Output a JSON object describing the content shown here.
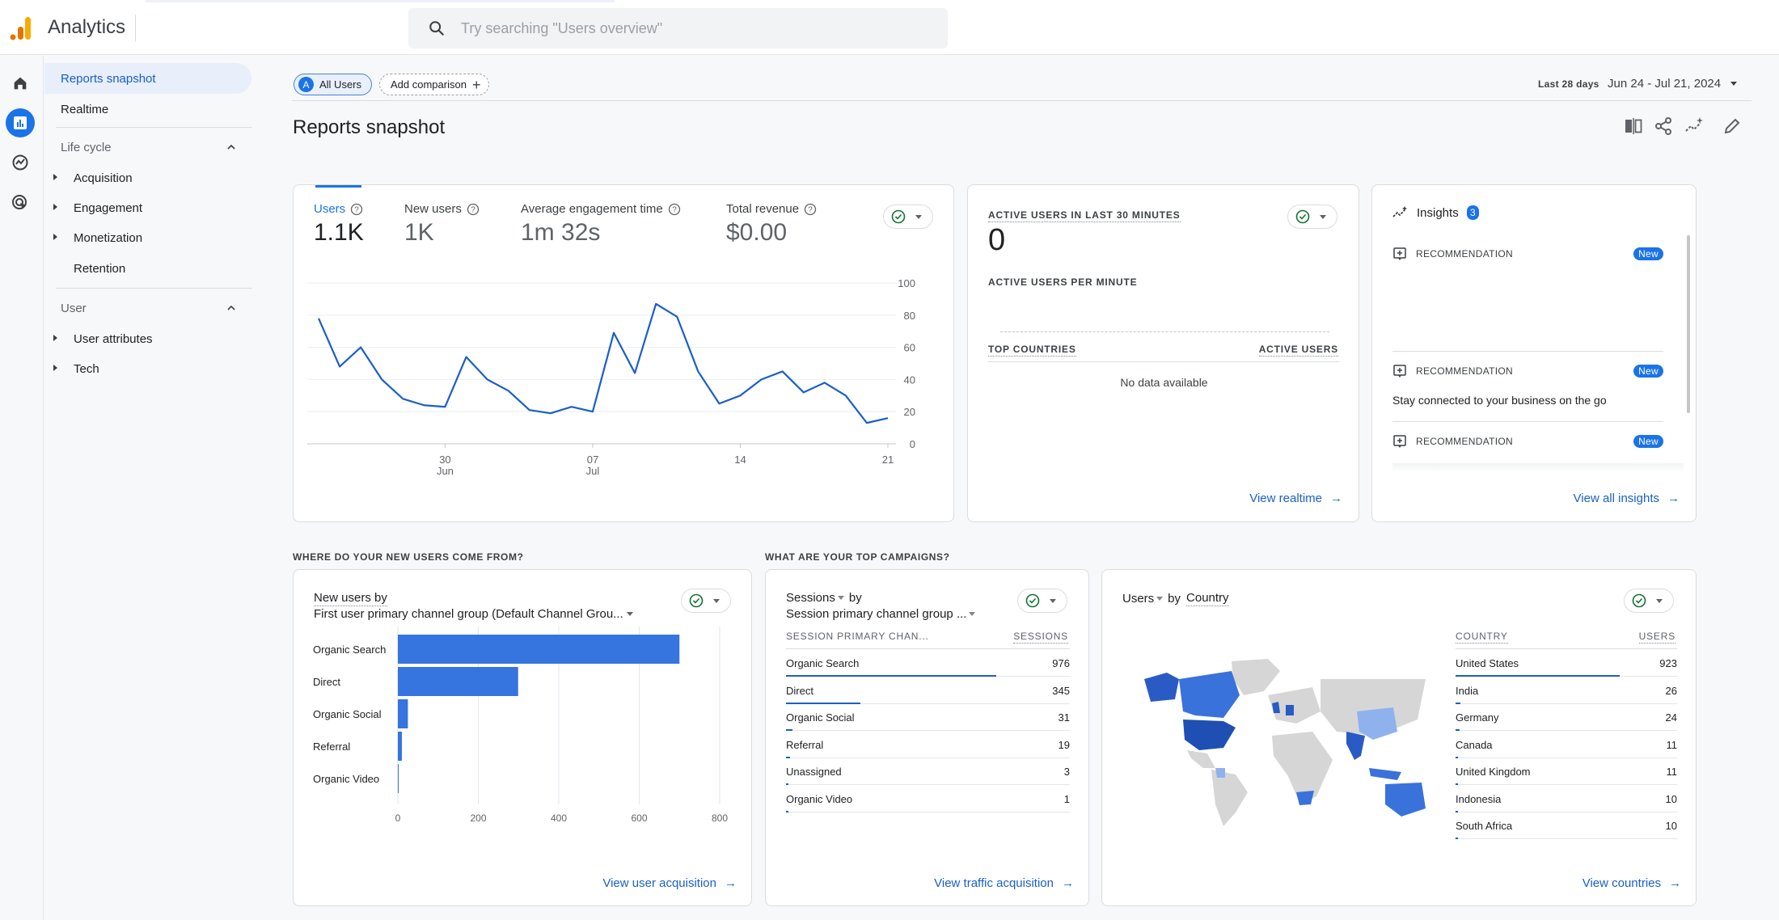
{
  "app": {
    "title": "Analytics"
  },
  "search": {
    "placeholder": "Try searching \"Users overview\"",
    "value": ""
  },
  "rail": [
    {
      "name": "home",
      "label": "Home"
    },
    {
      "name": "reports",
      "label": "Reports"
    },
    {
      "name": "explore",
      "label": "Explore"
    },
    {
      "name": "advertising",
      "label": "Advertising"
    }
  ],
  "nav": {
    "top_items": [
      "Reports snapshot",
      "Realtime"
    ],
    "sections": [
      {
        "title": "Life cycle",
        "items": [
          {
            "label": "Acquisition",
            "expandable": true
          },
          {
            "label": "Engagement",
            "expandable": true
          },
          {
            "label": "Monetization",
            "expandable": true
          },
          {
            "label": "Retention",
            "expandable": false
          }
        ]
      },
      {
        "title": "User",
        "items": [
          {
            "label": "User attributes",
            "expandable": true
          },
          {
            "label": "Tech",
            "expandable": true
          }
        ]
      }
    ]
  },
  "filters": {
    "segment_avatar": "A",
    "segment_label": "All Users",
    "add_comparison": "Add comparison",
    "date_range_label": "Last 28 days",
    "date_range_value": "Jun 24 - Jul 21, 2024"
  },
  "page": {
    "title": "Reports snapshot"
  },
  "toolbar": [
    "compare-icon",
    "share-icon",
    "insights-icon",
    "edit-icon"
  ],
  "metrics_card": {
    "metrics": [
      {
        "label": "Users",
        "value": "1.1K",
        "active": true
      },
      {
        "label": "New users",
        "value": "1K",
        "active": false
      },
      {
        "label": "Average engagement time",
        "value": "1m 32s",
        "active": false
      },
      {
        "label": "Total revenue",
        "value": "$0.00",
        "active": false
      }
    ]
  },
  "realtime_card": {
    "title": "ACTIVE USERS IN LAST 30 MINUTES",
    "value": "0",
    "per_minute_label": "ACTIVE USERS PER MINUTE",
    "col_country": "TOP COUNTRIES",
    "col_users": "ACTIVE USERS",
    "empty": "No data available",
    "link": "View realtime"
  },
  "insights_card": {
    "title": "Insights",
    "count": "3",
    "items": [
      {
        "type": "RECOMMENDATION",
        "badge": "New",
        "text": ""
      },
      {
        "type": "RECOMMENDATION",
        "badge": "New",
        "text": "Stay connected to your business on the go"
      },
      {
        "type": "RECOMMENDATION",
        "badge": "New",
        "text": ""
      }
    ],
    "link": "View all insights"
  },
  "sections": {
    "new_users_q": "WHERE DO YOUR NEW USERS COME FROM?",
    "campaigns_q": "WHAT ARE YOUR TOP CAMPAIGNS?"
  },
  "new_users_card": {
    "metric": "New users by",
    "dimension": "First user primary channel group (Default Channel Grou...",
    "link": "View user acquisition"
  },
  "sessions_card": {
    "metric": "Sessions",
    "by": "by",
    "dimension": "Session primary channel group ...",
    "col_dim": "SESSION PRIMARY CHAN...",
    "col_val": "SESSIONS",
    "rows": [
      {
        "label": "Organic Search",
        "value": "976",
        "n": 976
      },
      {
        "label": "Direct",
        "value": "345",
        "n": 345
      },
      {
        "label": "Organic Social",
        "value": "31",
        "n": 31
      },
      {
        "label": "Referral",
        "value": "19",
        "n": 19
      },
      {
        "label": "Unassigned",
        "value": "3",
        "n": 3
      },
      {
        "label": "Organic Video",
        "value": "1",
        "n": 1
      }
    ],
    "link": "View traffic acquisition"
  },
  "country_card": {
    "metric": "Users",
    "by": "by",
    "dimension": "Country",
    "col_dim": "COUNTRY",
    "col_val": "USERS",
    "rows": [
      {
        "label": "United States",
        "value": "923",
        "n": 923
      },
      {
        "label": "India",
        "value": "26",
        "n": 26
      },
      {
        "label": "Germany",
        "value": "24",
        "n": 24
      },
      {
        "label": "Canada",
        "value": "11",
        "n": 11
      },
      {
        "label": "United Kingdom",
        "value": "11",
        "n": 11
      },
      {
        "label": "Indonesia",
        "value": "10",
        "n": 10
      },
      {
        "label": "South Africa",
        "value": "10",
        "n": 10
      }
    ],
    "link": "View countries"
  },
  "colors": {
    "accent": "#1a73e8",
    "link": "#1a5fc8",
    "line": "#1a5fc8",
    "bar": "#3674e0",
    "check": "#137333"
  },
  "chart_data": [
    {
      "type": "line",
      "title": "Users",
      "x": [
        "Jun 24",
        "Jun 25",
        "Jun 26",
        "Jun 27",
        "Jun 28",
        "Jun 29",
        "Jun 30",
        "Jul 1",
        "Jul 2",
        "Jul 3",
        "Jul 4",
        "Jul 5",
        "Jul 6",
        "Jul 7",
        "Jul 8",
        "Jul 9",
        "Jul 10",
        "Jul 11",
        "Jul 12",
        "Jul 13",
        "Jul 14",
        "Jul 15",
        "Jul 16",
        "Jul 17",
        "Jul 18",
        "Jul 19",
        "Jul 20",
        "Jul 21"
      ],
      "series": [
        {
          "name": "Users",
          "values": [
            78,
            48,
            60,
            40,
            28,
            24,
            23,
            54,
            40,
            33,
            21,
            19,
            23,
            20,
            69,
            44,
            87,
            79,
            45,
            25,
            30,
            40,
            45,
            32,
            38,
            30,
            13,
            16
          ]
        }
      ],
      "x_ticks": [
        {
          "index": 6,
          "top": "30",
          "bottom": "Jun"
        },
        {
          "index": 13,
          "top": "07",
          "bottom": "Jul"
        },
        {
          "index": 20,
          "top": "14",
          "bottom": ""
        },
        {
          "index": 27,
          "top": "21",
          "bottom": ""
        }
      ],
      "y_ticks": [
        0,
        20,
        40,
        60,
        80,
        100
      ],
      "ylim": [
        0,
        100
      ],
      "grid": true,
      "y_axis_side": "right"
    },
    {
      "type": "bar",
      "orientation": "horizontal",
      "title": "New users by First user primary channel group (Default Channel Group)",
      "categories": [
        "Organic Search",
        "Direct",
        "Organic Social",
        "Referral",
        "Organic Video"
      ],
      "values": [
        700,
        299,
        25,
        10,
        1
      ],
      "x_ticks": [
        0,
        200,
        400,
        600,
        800
      ],
      "xlim": [
        0,
        800
      ],
      "grid": true
    }
  ]
}
